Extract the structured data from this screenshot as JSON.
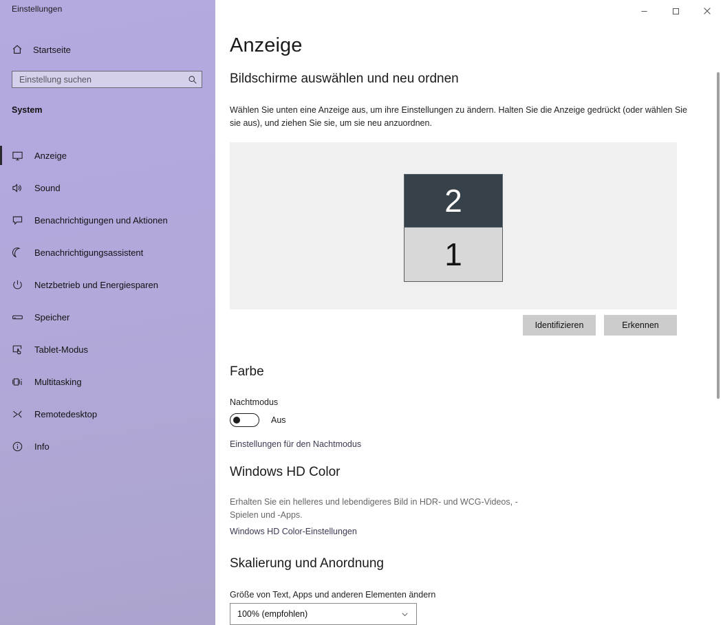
{
  "window": {
    "title": "Einstellungen",
    "controls": {
      "minimize": "minimize-icon",
      "maximize": "maximize-icon",
      "close": "close-icon"
    }
  },
  "sidebar": {
    "home_label": "Startseite",
    "home_icon": "home-icon",
    "search": {
      "placeholder": "Einstellung suchen",
      "value": "",
      "icon": "search-icon"
    },
    "group_header": "System",
    "items": [
      {
        "label": "Anzeige",
        "icon": "monitor-icon",
        "selected": true
      },
      {
        "label": "Sound",
        "icon": "speaker-icon",
        "selected": false
      },
      {
        "label": "Benachrichtigungen und Aktionen",
        "icon": "chat-bubble-icon",
        "selected": false
      },
      {
        "label": "Benachrichtigungsassistent",
        "icon": "moon-icon",
        "selected": false
      },
      {
        "label": "Netzbetrieb und Energiesparen",
        "icon": "power-icon",
        "selected": false
      },
      {
        "label": "Speicher",
        "icon": "drive-icon",
        "selected": false
      },
      {
        "label": "Tablet-Modus",
        "icon": "tablet-touch-icon",
        "selected": false
      },
      {
        "label": "Multitasking",
        "icon": "multitasking-icon",
        "selected": false
      },
      {
        "label": "Remotedesktop",
        "icon": "remote-desktop-icon",
        "selected": false
      },
      {
        "label": "Info",
        "icon": "info-icon",
        "selected": false
      }
    ]
  },
  "main": {
    "page_title": "Anzeige",
    "select_section": {
      "heading": "Bildschirme auswählen und neu ordnen",
      "description": "Wählen Sie unten eine Anzeige aus, um ihre Einstellungen zu ändern. Halten Sie die Anzeige gedrückt (oder wählen Sie sie aus), und ziehen Sie sie, um sie neu anzuordnen.",
      "monitors": [
        {
          "number": "2",
          "state": "selected"
        },
        {
          "number": "1",
          "state": "unselected"
        }
      ],
      "identify_button": "Identifizieren",
      "detect_button": "Erkennen"
    },
    "color_section": {
      "heading": "Farbe",
      "night_mode_label": "Nachtmodus",
      "night_mode_state": "Aus",
      "night_mode_link": "Einstellungen für den Nachtmodus"
    },
    "hdr_section": {
      "heading": "Windows HD Color",
      "description": "Erhalten Sie ein helleres und lebendigeres Bild in HDR- und WCG-Videos, -Spielen und -Apps.",
      "link": "Windows HD Color-Einstellungen"
    },
    "scaling_section": {
      "heading": "Skalierung und Anordnung",
      "size_label": "Größe von Text, Apps und anderen Elementen ändern",
      "scale_value": "100% (empfohlen)",
      "chevron_icon": "chevron-down-icon"
    }
  },
  "colors": {
    "sidebar_top": "#b5a9e0",
    "sidebar_bottom": "#aca4cd",
    "monitor_selected": "#374149",
    "monitor_unselected": "#d8d8d8",
    "button_face": "#cccccc",
    "preview_bg": "#f0f0f0",
    "link": "#3a3a52"
  }
}
